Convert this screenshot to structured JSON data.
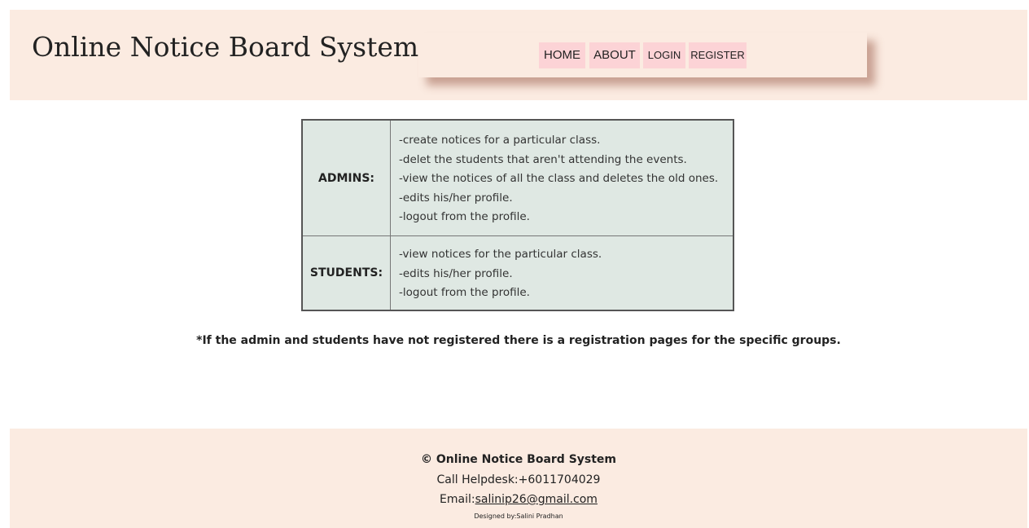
{
  "header": {
    "title": "Online Notice Board System",
    "nav": {
      "home": "HOME",
      "about": "ABOUT",
      "login": "LOGIN",
      "register": "REGISTER"
    }
  },
  "roles": {
    "admins": {
      "label": "ADMINS:",
      "items": [
        "-create notices for a particular class.",
        "-delet the students that aren't attending the events.",
        "-view the notices of all the class and deletes the old ones.",
        "-edits his/her profile.",
        "-logout from the profile."
      ]
    },
    "students": {
      "label": "STUDENTS:",
      "items": [
        "-view notices for the particular class.",
        "-edits his/her profile.",
        "-logout from the profile."
      ]
    }
  },
  "note": "*If the admin and students have not registered there is a registration pages for the specific groups.",
  "footer": {
    "copyright": "© Online Notice Board System",
    "helpdesk": "Call Helpdesk:+6011704029",
    "email_prefix": "Email:",
    "email": "salinip26@gmail.com",
    "designed_by": "Designed by:Salini Pradhan"
  },
  "colors": {
    "header_bg": "#fbebe1",
    "nav_button_bg": "#fcd3d6",
    "table_bg": "#dfe8e3"
  }
}
